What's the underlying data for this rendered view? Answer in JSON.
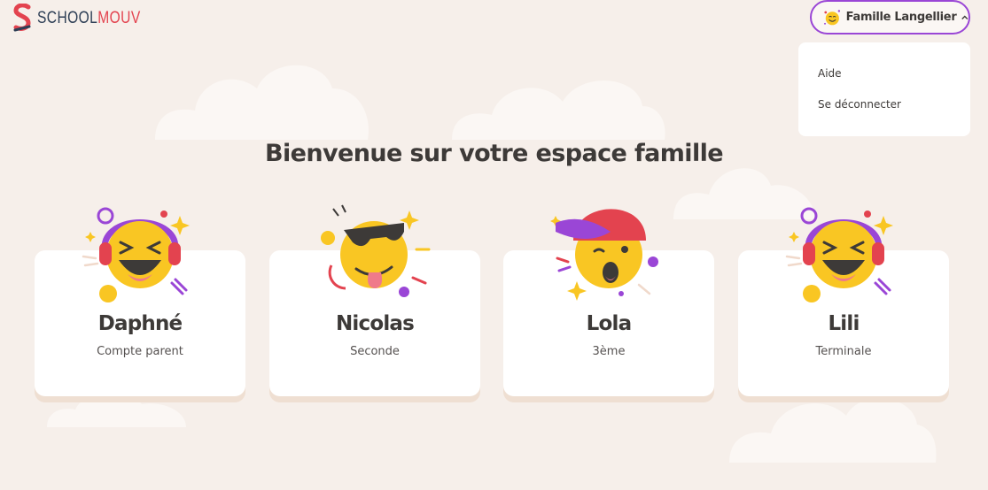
{
  "brand": {
    "part1": "SCHOOL",
    "part2": "MOUV"
  },
  "account": {
    "name": "Famille Langellier",
    "avatar_icon": "smiling-face-icon",
    "menu_icon": "chevron-up-icon"
  },
  "menu": {
    "items": [
      {
        "label": "Aide"
      },
      {
        "label": "Se déconnecter"
      }
    ]
  },
  "welcome": {
    "strong": "Bienvenue",
    "rest": " sur votre espace famille"
  },
  "profiles": [
    {
      "name": "Daphné",
      "level": "Compte parent",
      "avatar_icon": "laughing-face-with-headphones-icon"
    },
    {
      "name": "Nicolas",
      "level": "Seconde",
      "avatar_icon": "tongue-face-with-sunglasses-icon"
    },
    {
      "name": "Lola",
      "level": "3ème",
      "avatar_icon": "winking-face-with-cap-icon"
    },
    {
      "name": "Lili",
      "level": "Terminale",
      "avatar_icon": "laughing-face-with-headphones-icon"
    }
  ],
  "colors": {
    "background": "#f6efea",
    "accent_purple": "#9a46d6",
    "brand_red": "#e3434f",
    "brand_navy": "#2d3e55",
    "emoji_yellow": "#f9c623"
  }
}
